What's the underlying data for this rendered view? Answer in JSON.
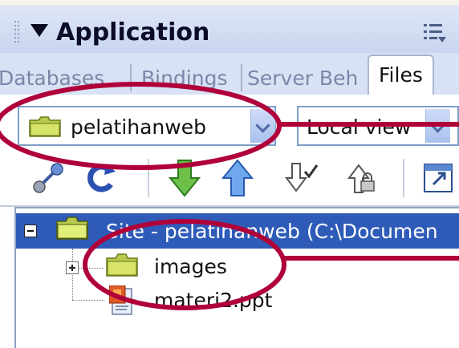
{
  "panel": {
    "title": "Application",
    "options_icon": "panel-options-icon"
  },
  "tabs": [
    {
      "label": "Databases",
      "active": false
    },
    {
      "label": "Bindings",
      "active": false
    },
    {
      "label": "Server Beh",
      "active": false
    },
    {
      "label": "Files",
      "active": true
    }
  ],
  "site_select": {
    "value": "pelatihanweb",
    "icon": "folder-icon"
  },
  "view_select": {
    "value": "Local view"
  },
  "toolbar": {
    "icons": [
      "connect-icon",
      "refresh-icon",
      "get-files-icon",
      "put-files-icon",
      "check-out-icon",
      "check-in-icon",
      "expand-icon"
    ]
  },
  "tree": {
    "root_label": "Site - pelatihanweb (C:\\Documen",
    "items": [
      {
        "label": "images",
        "icon": "folder-icon"
      },
      {
        "label": "materi2.ppt",
        "icon": "ppt-file-icon"
      }
    ]
  },
  "colors": {
    "panel_header": "#c9d6ef",
    "selection": "#2f5bb8",
    "annotation": "#b0003a"
  }
}
